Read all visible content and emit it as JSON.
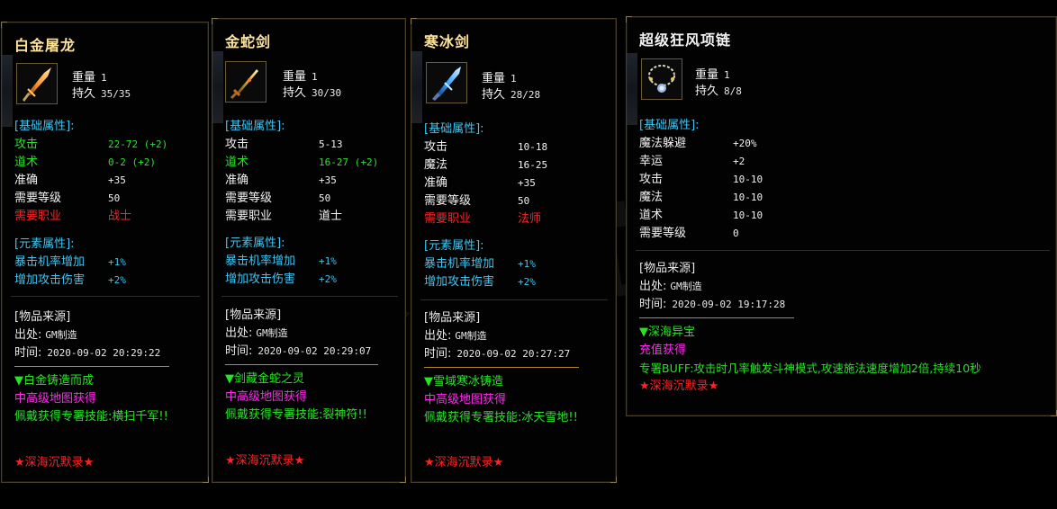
{
  "watermark": "深海沉默",
  "colors": {
    "gold_title": "#fde39a",
    "cyan": "#3ec4f2",
    "green": "#27e327",
    "red": "#ff2222",
    "magenta": "#ff2ced"
  },
  "items": [
    {
      "name": "白金屠龙",
      "icon": "flaming-sword-icon",
      "weight_label": "重量",
      "weight": "1",
      "dur_label": "持久",
      "dur": "35/35",
      "base_header": "[基础属性]:",
      "base": [
        {
          "k": "攻击",
          "v": "22-72 (+2)",
          "color": "green"
        },
        {
          "k": "道术",
          "v": "0-2 (+2)",
          "color": "green"
        },
        {
          "k": "准确",
          "v": "+35",
          "color": "white"
        },
        {
          "k": "需要等级",
          "v": "50",
          "color": "white"
        },
        {
          "k": "需要职业",
          "v": "战士",
          "color": "red"
        }
      ],
      "elem_header": "[元素属性]:",
      "elem": [
        {
          "k": "暴击机率增加",
          "v": "+1%"
        },
        {
          "k": "增加攻击伤害",
          "v": "+2%"
        }
      ],
      "src_header": "[物品来源]",
      "origin_label": "出处:",
      "origin": "GM制造",
      "time_label": "时间:",
      "time": "2020-09-02 20:29:22",
      "flavor1": "▼白金铸造而成",
      "flavor2": "中高级地图获得",
      "flavor3": "佩戴获得专署技能:横扫千军!!",
      "sig": "★深海沉默录★"
    },
    {
      "name": "金蛇剑",
      "icon": "golden-sword-icon",
      "weight_label": "重量",
      "weight": "1",
      "dur_label": "持久",
      "dur": "30/30",
      "base_header": "[基础属性]:",
      "base": [
        {
          "k": "攻击",
          "v": "5-13",
          "color": "white"
        },
        {
          "k": "道术",
          "v": "16-27 (+2)",
          "color": "green"
        },
        {
          "k": "准确",
          "v": "+35",
          "color": "white"
        },
        {
          "k": "需要等级",
          "v": "50",
          "color": "white"
        },
        {
          "k": "需要职业",
          "v": "道士",
          "color": "white"
        }
      ],
      "elem_header": "[元素属性]:",
      "elem": [
        {
          "k": "暴击机率增加",
          "v": "+1%"
        },
        {
          "k": "增加攻击伤害",
          "v": "+2%"
        }
      ],
      "src_header": "[物品来源]",
      "origin_label": "出处:",
      "origin": "GM制造",
      "time_label": "时间:",
      "time": "2020-09-02 20:29:07",
      "flavor1": "▼剑藏金蛇之灵",
      "flavor2": "中高级地图获得",
      "flavor3": "佩戴获得专署技能:裂神符!!",
      "sig": "★深海沉默录★"
    },
    {
      "name": "寒冰剑",
      "icon": "ice-sword-icon",
      "weight_label": "重量",
      "weight": "1",
      "dur_label": "持久",
      "dur": "28/28",
      "base_header": "[基础属性]:",
      "base": [
        {
          "k": "攻击",
          "v": "10-18",
          "color": "white"
        },
        {
          "k": "魔法",
          "v": "16-25",
          "color": "white"
        },
        {
          "k": "准确",
          "v": "+35",
          "color": "white"
        },
        {
          "k": "需要等级",
          "v": "50",
          "color": "white"
        },
        {
          "k": "需要职业",
          "v": "法师",
          "color": "red"
        }
      ],
      "elem_header": "[元素属性]:",
      "elem": [
        {
          "k": "暴击机率增加",
          "v": "+1%"
        },
        {
          "k": "增加攻击伤害",
          "v": "+2%"
        }
      ],
      "src_header": "[物品来源]",
      "origin_label": "出处:",
      "origin": "GM制造",
      "time_label": "时间:",
      "time": "2020-09-02 20:27:27",
      "flavor1": "▼雪域寒冰铸造",
      "flavor2": "中高级地图获得",
      "flavor3": "佩戴获得专署技能:冰天雪地!!",
      "sig": "★深海沉默录★"
    },
    {
      "name": "超级狂风项链",
      "icon": "necklace-icon",
      "weight_label": "重量",
      "weight": "1",
      "dur_label": "持久",
      "dur": "8/8",
      "base_header": "[基础属性]:",
      "base": [
        {
          "k": "魔法躲避",
          "v": "+20%",
          "color": "white"
        },
        {
          "k": "幸运",
          "v": "+2",
          "color": "white"
        },
        {
          "k": "攻击",
          "v": "10-10",
          "color": "white"
        },
        {
          "k": "魔法",
          "v": "10-10",
          "color": "white"
        },
        {
          "k": "道术",
          "v": "10-10",
          "color": "white"
        },
        {
          "k": "需要等级",
          "v": "0",
          "color": "white"
        }
      ],
      "src_header": "[物品来源]",
      "origin_label": "出处:",
      "origin": "GM制造",
      "time_label": "时间:",
      "time": "2020-09-02 19:17:28",
      "flavor1": "▼深海异宝",
      "flavor2": "充值获得",
      "flavor3": "专署BUFF:攻击时几率触发斗神模式,攻速施法速度增加2倍,持续10秒",
      "sig": "★深海沉默录★"
    }
  ]
}
